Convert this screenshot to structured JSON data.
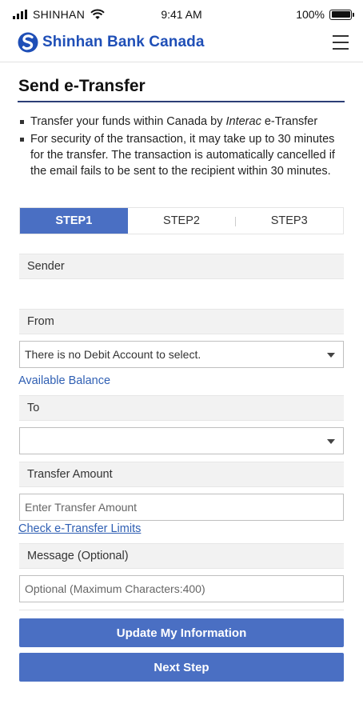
{
  "status_bar": {
    "carrier": "SHINHAN",
    "time": "9:41 AM",
    "battery_percent": "100%",
    "battery_level": 1.0
  },
  "header": {
    "logo_icon": "shinhan-logo-icon",
    "brand": "Shinhan Bank Canada",
    "menu_icon": "hamburger-menu-icon",
    "brand_color": "#1f4fb7"
  },
  "page": {
    "title": "Send e-Transfer",
    "notes": [
      {
        "before": "Transfer your funds within Canada by ",
        "emphasis": "Interac",
        "after": " e-Transfer"
      },
      {
        "text": "For security of the transaction, it may take up to 30 minutes for the transfer. The transaction is automatically cancelled if the email fails to be sent to the recipient within 30 minutes."
      }
    ]
  },
  "steps": [
    {
      "label": "STEP1",
      "active": true
    },
    {
      "label": "STEP2",
      "active": false
    },
    {
      "label": "STEP3",
      "active": false
    }
  ],
  "form": {
    "sender_label": "Sender",
    "from_label": "From",
    "from_select_value": "There is no Debit Account to select.",
    "available_balance_link": "Available Balance",
    "to_label": "To",
    "to_select_value": "",
    "amount_label": "Transfer Amount",
    "amount_placeholder": "Enter Transfer Amount",
    "limits_link": "Check e-Transfer Limits",
    "message_label": "Message (Optional)",
    "message_placeholder": "Optional (Maximum Characters:400)"
  },
  "actions": {
    "update_label": "Update My Information",
    "next_label": "Next Step"
  },
  "colors": {
    "accent": "#4a6fc3",
    "link": "#2f5fb3",
    "title_rule": "#2c3e76"
  }
}
